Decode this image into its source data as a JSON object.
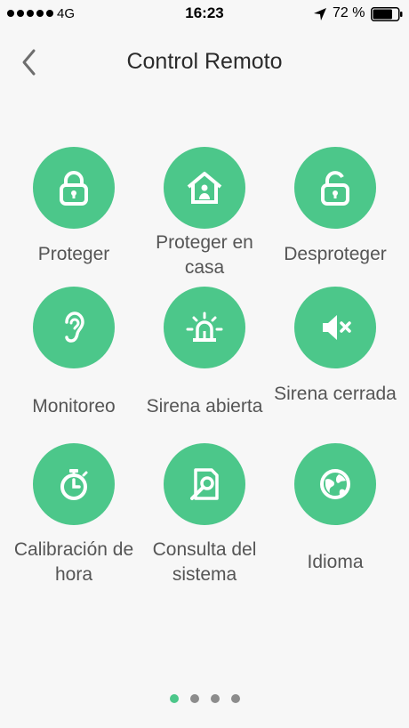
{
  "status_bar": {
    "carrier": "4G",
    "time": "16:23",
    "battery_percent": "72 %"
  },
  "nav": {
    "back_icon": "chevron-left-icon",
    "title": "Control Remoto"
  },
  "accent_color": "#4cc78a",
  "actions": [
    {
      "label": "Proteger",
      "icon": "lock-icon"
    },
    {
      "label": "Proteger en casa",
      "icon": "home-person-icon"
    },
    {
      "label": "Desproteger",
      "icon": "unlock-icon"
    },
    {
      "label": "Monitoreo",
      "icon": "ear-icon"
    },
    {
      "label": "Sirena abierta",
      "icon": "siren-icon"
    },
    {
      "label": "Sirena cerrada",
      "icon": "speaker-mute-icon"
    },
    {
      "label": "Calibración de hora",
      "icon": "stopwatch-icon"
    },
    {
      "label": "Consulta del sistema",
      "icon": "document-search-icon"
    },
    {
      "label": "Idioma",
      "icon": "globe-icon"
    }
  ],
  "pager": {
    "page_count": 4,
    "active_page": 1
  }
}
